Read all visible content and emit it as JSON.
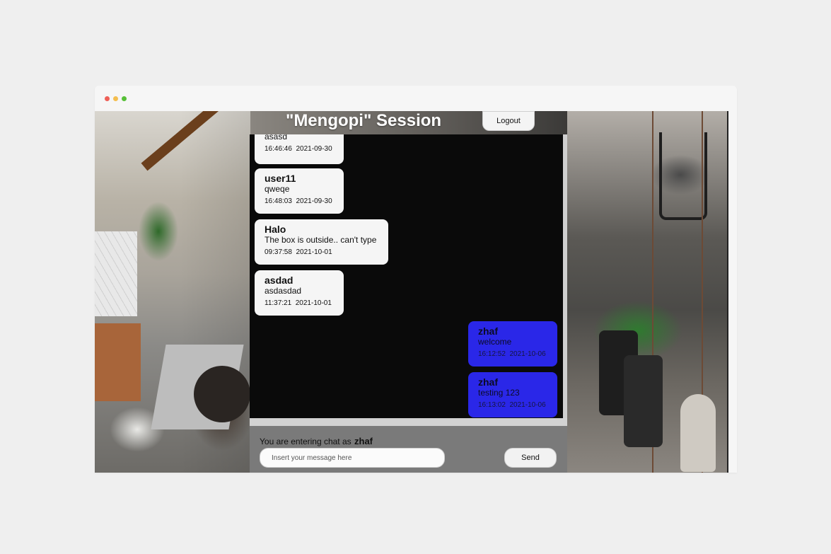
{
  "session": {
    "title": "\"Mengopi\" Session",
    "logout_label": "Logout"
  },
  "messages": [
    {
      "side": "left",
      "user": "",
      "text": "asasd",
      "time": "16:46:46",
      "date": "2021-09-30"
    },
    {
      "side": "left",
      "user": "user11",
      "text": "qweqe",
      "time": "16:48:03",
      "date": "2021-09-30"
    },
    {
      "side": "left",
      "user": "Halo",
      "text": "The box is outside.. can't type",
      "time": "09:37:58",
      "date": "2021-10-01"
    },
    {
      "side": "left",
      "user": "asdad",
      "text": "asdasdad",
      "time": "11:37:21",
      "date": "2021-10-01"
    },
    {
      "side": "right",
      "user": "zhaf",
      "text": "welcome",
      "time": "16:12:52",
      "date": "2021-10-06"
    },
    {
      "side": "right",
      "user": "zhaf",
      "text": "testing 123",
      "time": "16:13:02",
      "date": "2021-10-06"
    }
  ],
  "composer": {
    "label": "You are entering chat as",
    "username": "zhaf",
    "placeholder": "Insert your message here",
    "send_label": "Send"
  },
  "colors": {
    "own_bubble": "#2a27e8",
    "other_bubble": "#f5f5f5",
    "chat_bg": "#0a0a0a"
  }
}
